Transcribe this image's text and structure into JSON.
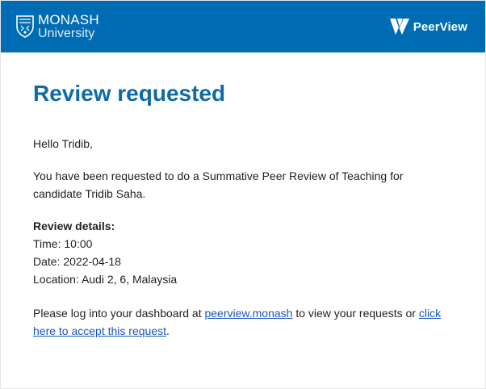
{
  "header": {
    "university_name": "MONASH",
    "university_sub": "University",
    "product_name": "PeerView",
    "background_color": "#006cb3"
  },
  "email": {
    "title": "Review requested",
    "greeting": "Hello Tridib,",
    "intro": "You have been requested to do a Summative Peer Review of Teaching for candidate Tridib Saha.",
    "details_heading": "Review details:",
    "details": {
      "time": "Time: 10:00",
      "date": "Date: 2022-04-18",
      "location": "Location: Audi 2, 6, Malaysia"
    },
    "cta": {
      "before_link": "Please log into your dashboard at ",
      "dashboard_link": "peerview.monash",
      "middle": " to view your requests or ",
      "accept_link": "click here to accept this request",
      "after": "."
    }
  },
  "colors": {
    "title": "#0e6aa8",
    "link": "#1a55c4"
  },
  "icons": {
    "university": "monash-shield-icon",
    "product": "peerview-logo-icon"
  }
}
